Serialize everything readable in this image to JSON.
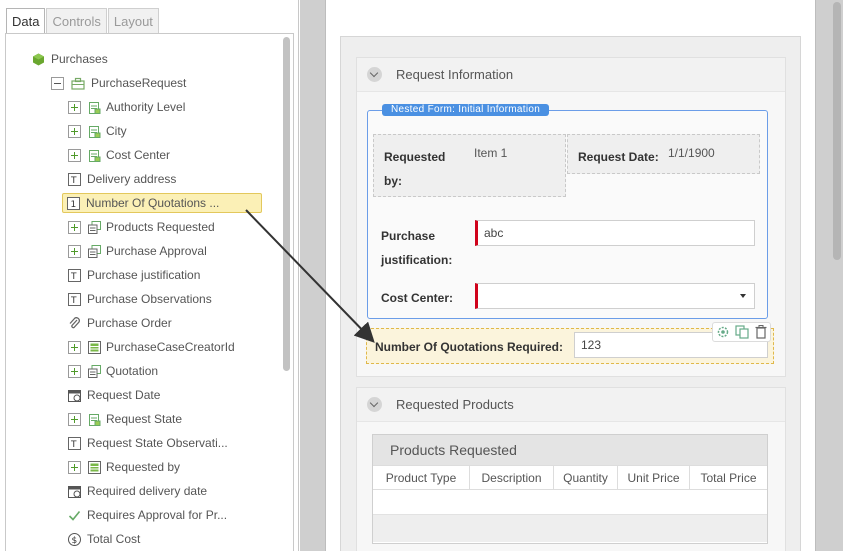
{
  "tabs": [
    "Data",
    "Controls",
    "Layout"
  ],
  "tree": {
    "root": "Purchases",
    "entity": "PurchaseRequest",
    "items": [
      {
        "label": "Authority Level",
        "expand": true,
        "icon": "entity-icon"
      },
      {
        "label": "City",
        "expand": true,
        "icon": "entity-icon"
      },
      {
        "label": "Cost Center",
        "expand": true,
        "icon": "entity-icon"
      },
      {
        "label": "Delivery address",
        "expand": false,
        "icon": "text-icon"
      },
      {
        "label": "Number Of Quotations ...",
        "expand": false,
        "icon": "number-icon",
        "selected": true
      },
      {
        "label": "Products Requested",
        "expand": true,
        "icon": "collection-icon"
      },
      {
        "label": "Purchase Approval",
        "expand": true,
        "icon": "collection-icon"
      },
      {
        "label": "Purchase justification",
        "expand": false,
        "icon": "text-icon"
      },
      {
        "label": "Purchase Observations",
        "expand": false,
        "icon": "text-icon"
      },
      {
        "label": "Purchase Order",
        "expand": false,
        "icon": "attachment-icon"
      },
      {
        "label": "PurchaseCaseCreatorId",
        "expand": true,
        "icon": "table-icon"
      },
      {
        "label": "Quotation",
        "expand": true,
        "icon": "collection-icon"
      },
      {
        "label": "Request Date",
        "expand": false,
        "icon": "calendar-icon"
      },
      {
        "label": "Request State",
        "expand": true,
        "icon": "entity-icon"
      },
      {
        "label": "Request State Observati...",
        "expand": false,
        "icon": "text-icon"
      },
      {
        "label": "Requested by",
        "expand": true,
        "icon": "table-icon"
      },
      {
        "label": "Required delivery date",
        "expand": false,
        "icon": "calendar-icon"
      },
      {
        "label": "Requires Approval for Pr...",
        "expand": false,
        "icon": "check-icon"
      },
      {
        "label": "Total Cost",
        "expand": false,
        "icon": "currency-icon"
      }
    ]
  },
  "form": {
    "section1": "Request Information",
    "nested_title": "Nested Form: Initial Information",
    "requested_by_label": "Requested by:",
    "requested_by_value": "Item 1",
    "request_date_label": "Request Date:",
    "request_date_value": "1/1/1900",
    "purchase_just_label": "Purchase justification:",
    "purchase_just_value": "abc",
    "cost_center_label": "Cost Center:",
    "quotations_label": "Number Of Quotations Required:",
    "quotations_value": "123",
    "section2": "Requested Products",
    "grid_title": "Products Requested",
    "grid_columns": [
      "Product Type",
      "Description",
      "Quantity",
      "Unit Price",
      "Total Price"
    ]
  },
  "colors": {
    "accent": "#4a90e2",
    "required": "#d0021b",
    "highlight": "#fbf0b6"
  }
}
